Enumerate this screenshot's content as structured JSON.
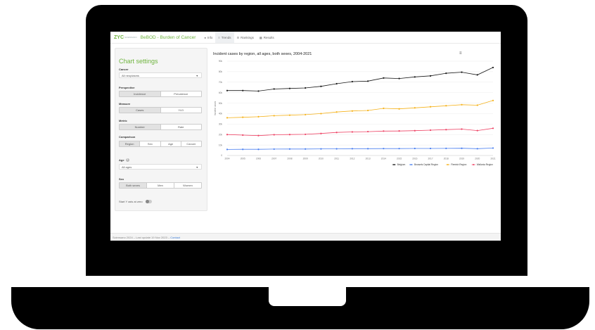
{
  "header": {
    "logo_mark": "ZYC",
    "logo_sub": "SCIENSANO",
    "app_title": "BeBOD - Burden of Cancer",
    "tabs": [
      {
        "icon": "info-icon",
        "glyph": "●",
        "label": "Info"
      },
      {
        "icon": "trends-icon",
        "glyph": "≡",
        "label": "Trends"
      },
      {
        "icon": "rankings-icon",
        "glyph": "☰",
        "label": "Rankings"
      },
      {
        "icon": "results-icon",
        "glyph": "▦",
        "label": "Results"
      }
    ]
  },
  "sidebar": {
    "title": "Chart settings",
    "cancer": {
      "label": "Cancer",
      "value": "All neoplasms"
    },
    "perspective": {
      "label": "Perspective",
      "options": [
        "Incidence",
        "Prevalence"
      ],
      "selected": 0
    },
    "measure": {
      "label": "Measure",
      "options": [
        "Cases",
        "YLD"
      ],
      "selected": 0
    },
    "metric": {
      "label": "Metric",
      "options": [
        "Number",
        "Rate"
      ],
      "selected": 0
    },
    "comparison": {
      "label": "Comparison",
      "options": [
        "Region",
        "Sex",
        "Age",
        "Cancer"
      ],
      "selected": 0
    },
    "age": {
      "label": "Age",
      "value": "All ages"
    },
    "sex": {
      "label": "Sex",
      "options": [
        "Both sexes",
        "Men",
        "Women"
      ],
      "selected": 0
    },
    "start_y_axis": {
      "label": "Start Y axis at zero",
      "on": false
    }
  },
  "chart_data": {
    "type": "line",
    "title": "Incident cases by region, all ages, both sexes, 2004-2021",
    "ylabel": "Incident cases",
    "x": [
      "2004",
      "2005",
      "2006",
      "2007",
      "2008",
      "2009",
      "2010",
      "2011",
      "2012",
      "2013",
      "2014",
      "2015",
      "2016",
      "2017",
      "2018",
      "2019",
      "2020",
      "2021"
    ],
    "ylim": [
      0,
      90000
    ],
    "yticks": [
      "0",
      "10k",
      "20k",
      "30k",
      "40k",
      "50k",
      "60k",
      "70k",
      "80k",
      "90k"
    ],
    "series": [
      {
        "name": "Belgium",
        "color": "#1a1a1a",
        "values": [
          62000,
          62000,
          61500,
          63500,
          64000,
          64500,
          66000,
          68500,
          70500,
          71000,
          74000,
          73500,
          75000,
          76000,
          78500,
          79500,
          77000,
          84000
        ]
      },
      {
        "name": "Brussels Capital Region",
        "color": "#4a7ff0",
        "values": [
          5800,
          5900,
          5900,
          6100,
          6200,
          6200,
          6300,
          6400,
          6500,
          6500,
          6600,
          6600,
          6700,
          6700,
          6800,
          6900,
          6500,
          7100
        ]
      },
      {
        "name": "Flemish Region",
        "color": "#f5b21b",
        "values": [
          36000,
          36500,
          37000,
          38000,
          38500,
          39000,
          40000,
          41500,
          42500,
          43000,
          45000,
          44500,
          45500,
          46500,
          47500,
          48500,
          48000,
          52500
        ]
      },
      {
        "name": "Wallonia Region",
        "color": "#ee4466",
        "values": [
          20000,
          19500,
          19000,
          19800,
          20000,
          20200,
          21000,
          22000,
          22500,
          22800,
          23300,
          23400,
          23700,
          24200,
          24700,
          25200,
          23800,
          26000
        ]
      }
    ],
    "legend_position": "bottom-right"
  },
  "menu_icon": "hamburger-icon",
  "footer": {
    "text": "Sciensano 2024 – Last update 19 Nov 2023 –",
    "link": "Contact"
  }
}
